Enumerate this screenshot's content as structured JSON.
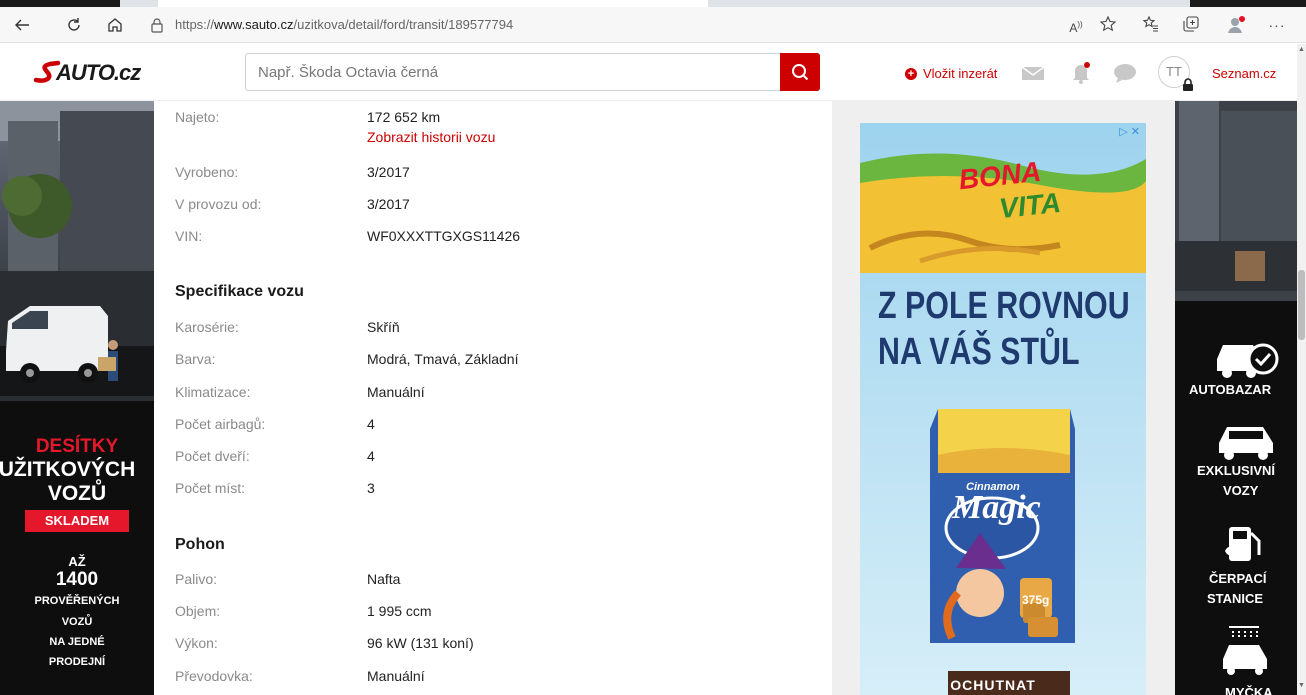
{
  "browser": {
    "url_prefix": "https://",
    "url_host": "www.sauto.cz",
    "url_path": "/uzitkova/detail/ford/transit/189577794"
  },
  "header": {
    "logo_text": "SAUTO.cz",
    "search_placeholder": "Např. Škoda Octavia černá",
    "post_ad_label": "Vložit inzerát",
    "avatar_initials": "TT",
    "seznam_label": "Seznam.cz"
  },
  "vehicle": {
    "basic": [
      {
        "label": "Najeto:",
        "value": "172 652 km",
        "link": "Zobrazit historii vozu"
      },
      {
        "label": "Vyrobeno:",
        "value": "3/2017"
      },
      {
        "label": "V provozu od:",
        "value": "3/2017"
      },
      {
        "label": "VIN:",
        "value": "WF0XXXTTGXGS11426"
      }
    ],
    "spec_title": "Specifikace vozu",
    "spec": [
      {
        "label": "Karosérie:",
        "value": "Skříň"
      },
      {
        "label": "Barva:",
        "value": "Modrá, Tmavá, Základní"
      },
      {
        "label": "Klimatizace:",
        "value": "Manuální"
      },
      {
        "label": "Počet airbagů:",
        "value": "4"
      },
      {
        "label": "Počet dveří:",
        "value": "4"
      },
      {
        "label": "Počet míst:",
        "value": "3"
      }
    ],
    "drive_title": "Pohon",
    "drive": [
      {
        "label": "Palivo:",
        "value": "Nafta"
      },
      {
        "label": "Objem:",
        "value": "1 995 ccm"
      },
      {
        "label": "Výkon:",
        "value": "96 kW (131 koní)"
      },
      {
        "label": "Převodovka:",
        "value": "Manuální"
      }
    ]
  },
  "left_banner": {
    "line1": "DESÍTKY",
    "line2": "UŽITKOVÝCH",
    "line3": "VOZŮ",
    "badge": "SKLADEM",
    "line4": "AŽ",
    "line5": "1400",
    "line6": "PROVĚŘENÝCH",
    "line7": "VOZŮ",
    "line8": "NA JEDNÉ",
    "line9": "PRODEJNÍ"
  },
  "right_banner": {
    "item1": "AUTOBAZAR",
    "item2a": "EXKLUSIVNÍ",
    "item2b": "VOZY",
    "item3a": "ČERPACÍ",
    "item3b": "STANICE",
    "item4": "MYČKA"
  },
  "ad": {
    "brand_line1": "BONA",
    "brand_line2": "VITA",
    "headline1": "Z POLE ROVNOU",
    "headline2": "NA VÁŠ STŮL",
    "product_small": "Cinnamon",
    "product_name": "Magic",
    "weight": "375g",
    "cta": "OCHUTNAT",
    "adchoices": "▷ ✕"
  },
  "colors": {
    "brand_red": "#cc0000",
    "label_gray": "#8a8a8a",
    "ad_headline": "#1f3a6e",
    "side_red": "#e4172b"
  }
}
